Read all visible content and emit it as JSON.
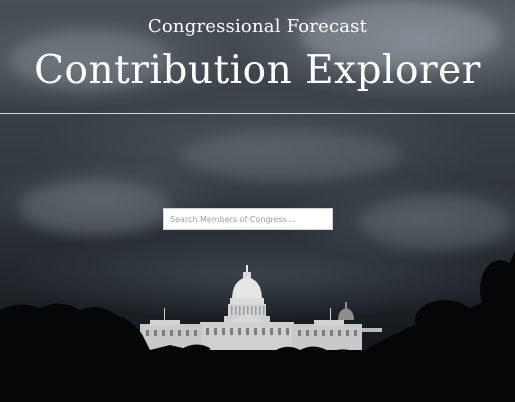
{
  "header": {
    "subtitle": "Congressional Forecast",
    "title": "Contribution Explorer"
  },
  "search": {
    "placeholder": "Search Members of Congress...",
    "value": ""
  },
  "background": {
    "image": "stormy-sky-capitol-photo"
  }
}
